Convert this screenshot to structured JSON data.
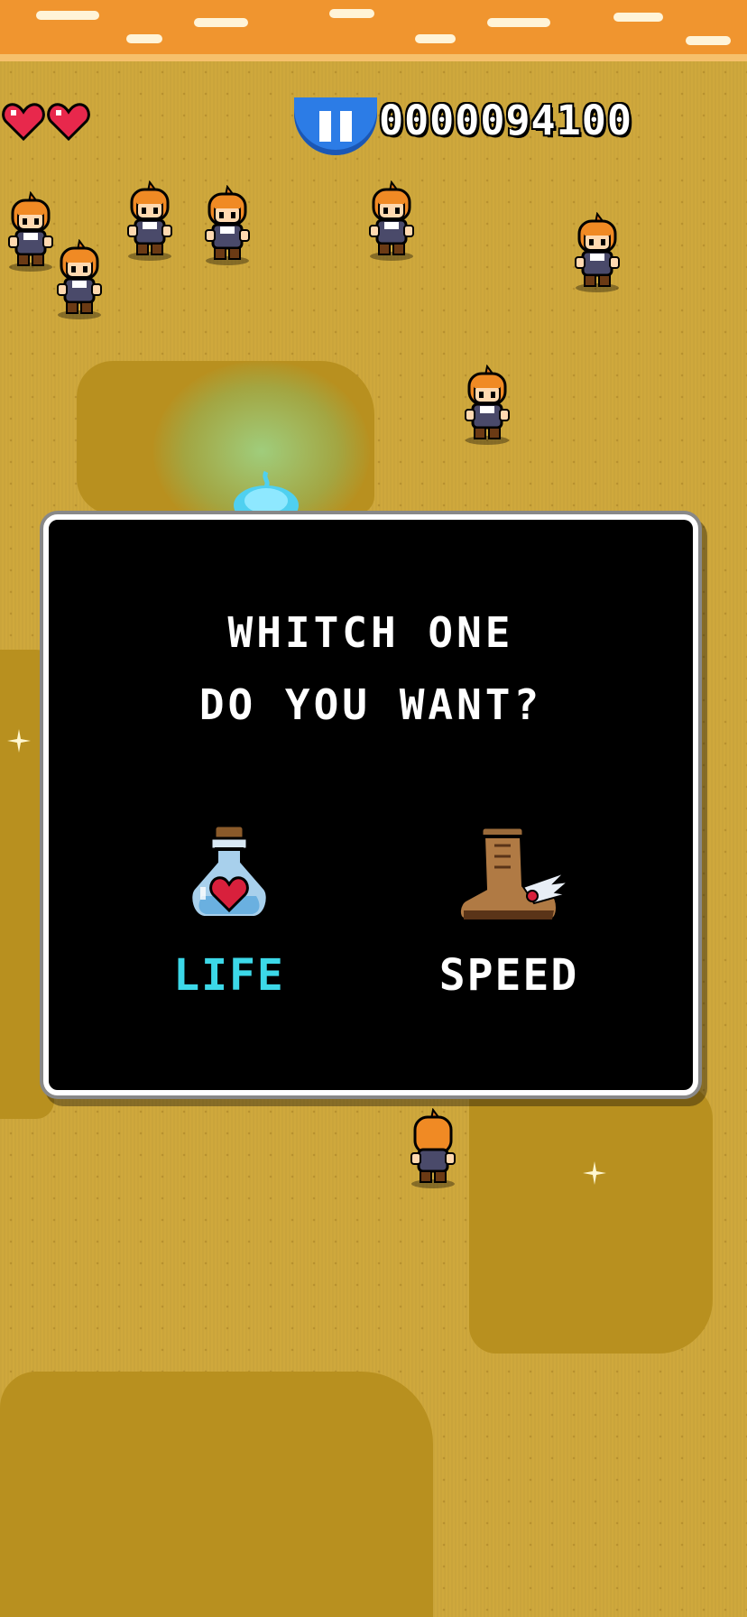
{
  "hud": {
    "lives": 2,
    "score": "0000094100",
    "heart_color": "#e8284c",
    "pause_color": "#2c7ce6"
  },
  "dialog": {
    "question_line1": "WHITCH ONE",
    "question_line2": "DO YOU WANT?",
    "choices": [
      {
        "label": "LIFE",
        "icon": "heart-potion-icon",
        "selected": true,
        "color": "#3cd8e8"
      },
      {
        "label": "SPEED",
        "icon": "winged-boot-icon",
        "selected": false,
        "color": "#ffffff"
      }
    ]
  },
  "scene": {
    "sky_color": "#f0952f",
    "ground_color": "#cfa83c",
    "enemy_count": 9
  }
}
